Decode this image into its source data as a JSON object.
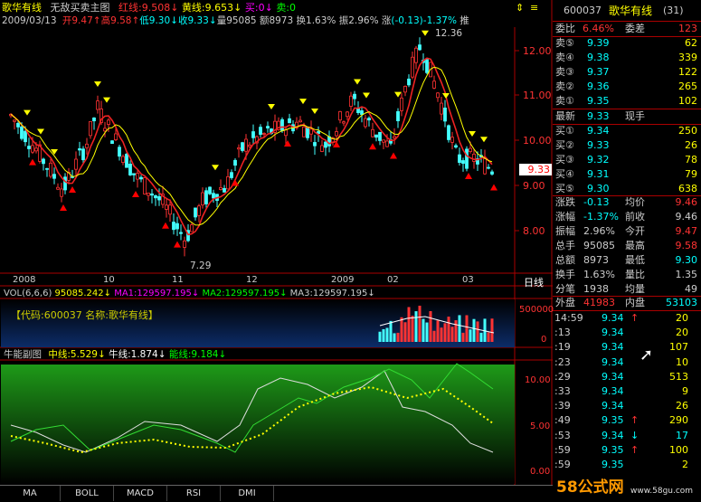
{
  "header": {
    "stock_name": "歌华有线",
    "window_title": "无敌买卖主图",
    "red_line_label": "红线:",
    "red_line_value": "9.508",
    "yellow_line_label": "黄线:",
    "yellow_line_value": "9.653",
    "buy_label": "买:",
    "buy_value": "0",
    "sell_label": "卖:",
    "sell_value": "0",
    "date": "2009/03/13",
    "open_label": "开",
    "open_value": "9.47",
    "high_label": "高",
    "high_value": "9.58",
    "low_label": "低",
    "low_value": "9.30",
    "close_label": "收",
    "close_value": "9.33",
    "volume_label": "量",
    "volume_value": "95085",
    "amount_label": "额",
    "amount_value": "8973",
    "turnover_label": "换",
    "turnover_value": "1.63%",
    "amplitude_label": "振",
    "amplitude_value": "2.96%",
    "change_label": "涨",
    "change_value": "(-0.13)",
    "change_pct": "-1.37%",
    "trailing": "推"
  },
  "main_chart": {
    "price_ticks": [
      "12.00",
      "11.00",
      "10.00",
      "9.00",
      "8.00"
    ],
    "high_annotation": "12.36",
    "low_annotation": "7.29",
    "current_price_tag": "9.33",
    "date_labels": [
      "2008",
      "10",
      "11",
      "12",
      "2009",
      "02",
      "03"
    ],
    "period_label": "日线"
  },
  "volume_panel": {
    "label": "VOL(6,6,6)",
    "vol_value": "95085.242",
    "ma1_label": "MA1:",
    "ma1_value": "129597.195",
    "ma2_label": "MA2:",
    "ma2_value": "129597.195",
    "ma3_label": "MA3:",
    "ma3_value": "129597.195",
    "info_text": "【代码:600037 名称:歌华有线】",
    "ticks": [
      "500000",
      "0"
    ]
  },
  "indicator_panel": {
    "title": "牛能副图",
    "mid_label": "中线:",
    "mid_value": "5.529",
    "bull_label": "牛线:",
    "bull_value": "1.874",
    "energy_label": "能线:",
    "energy_value": "9.184",
    "ticks": [
      "10.00",
      "5.00",
      "0.00"
    ]
  },
  "tabs": [
    "MA",
    "BOLL",
    "MACD",
    "RSI",
    "DMI"
  ],
  "right_panel": {
    "code": "600037",
    "name": "歌华有线",
    "count": "(31)",
    "weibi_label": "委比",
    "weibi_value": "6.46%",
    "weicha_label": "委差",
    "weicha_value": "123",
    "sells": [
      {
        "label": "卖⑤",
        "price": "9.39",
        "vol": "62"
      },
      {
        "label": "卖④",
        "price": "9.38",
        "vol": "339"
      },
      {
        "label": "卖③",
        "price": "9.37",
        "vol": "122"
      },
      {
        "label": "卖②",
        "price": "9.36",
        "vol": "265"
      },
      {
        "label": "卖①",
        "price": "9.35",
        "vol": "102"
      }
    ],
    "latest_label": "最新",
    "latest_value": "9.33",
    "xianshou_label": "现手",
    "buys": [
      {
        "label": "买①",
        "price": "9.34",
        "vol": "250"
      },
      {
        "label": "买②",
        "price": "9.33",
        "vol": "26"
      },
      {
        "label": "买③",
        "price": "9.32",
        "vol": "78"
      },
      {
        "label": "买④",
        "price": "9.31",
        "vol": "79"
      },
      {
        "label": "买⑤",
        "price": "9.30",
        "vol": "638"
      }
    ],
    "stats": [
      {
        "l1": "涨跌",
        "v1": "-0.13",
        "l2": "均价",
        "v2": "9.46"
      },
      {
        "l1": "涨幅",
        "v1": "-1.37%",
        "l2": "前收",
        "v2": "9.46"
      },
      {
        "l1": "振幅",
        "v1": "2.96%",
        "l2": "今开",
        "v2": "9.47"
      },
      {
        "l1": "总手",
        "v1": "95085",
        "l2": "最高",
        "v2": "9.58"
      },
      {
        "l1": "总额",
        "v1": "8973",
        "l2": "最低",
        "v2": "9.30"
      },
      {
        "l1": "换手",
        "v1": "1.63%",
        "l2": "量比",
        "v2": "1.35"
      },
      {
        "l1": "分笔",
        "v1": "1938",
        "l2": "均量",
        "v2": "49"
      }
    ],
    "outer_label": "外盘",
    "outer_value": "41983",
    "inner_label": "内盘",
    "inner_value": "53103",
    "ticks": [
      {
        "t": "14:59",
        "p": "9.34",
        "d": "↑",
        "v": "20"
      },
      {
        "t": ":13",
        "p": "9.34",
        "d": "",
        "v": "20"
      },
      {
        "t": ":19",
        "p": "9.34",
        "d": "",
        "v": "107"
      },
      {
        "t": ":23",
        "p": "9.34",
        "d": "",
        "v": "10"
      },
      {
        "t": ":29",
        "p": "9.34",
        "d": "",
        "v": "513"
      },
      {
        "t": ":33",
        "p": "9.34",
        "d": "",
        "v": "9"
      },
      {
        "t": ":39",
        "p": "9.34",
        "d": "",
        "v": "26"
      },
      {
        "t": ":49",
        "p": "9.35",
        "d": "↑",
        "v": "290"
      },
      {
        "t": ":53",
        "p": "9.34",
        "d": "↓",
        "v": "17"
      },
      {
        "t": ":59",
        "p": "9.35",
        "d": "↑",
        "v": "100"
      },
      {
        "t": ":59",
        "p": "9.35",
        "d": "",
        "v": "2"
      }
    ],
    "watermark_logo": "58公式网",
    "watermark_url": "www.58gu.com"
  }
}
